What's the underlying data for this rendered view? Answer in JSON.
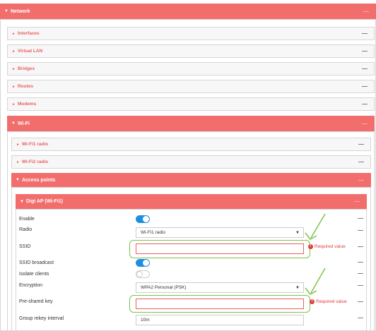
{
  "network": {
    "title": "Network",
    "arrow": "▼",
    "dash": "—"
  },
  "sections": [
    {
      "label": "Interfaces",
      "arrow": "►",
      "dash": "—"
    },
    {
      "label": "Virtual LAN",
      "arrow": "►",
      "dash": "—"
    },
    {
      "label": "Bridges",
      "arrow": "►",
      "dash": "—"
    },
    {
      "label": "Routes",
      "arrow": "►",
      "dash": "—"
    },
    {
      "label": "Modems",
      "arrow": "►",
      "dash": "—"
    }
  ],
  "wifi": {
    "title": "Wi-Fi",
    "arrow": "▼",
    "dash": "—",
    "radios": [
      {
        "label": "Wi-Fi1 radio",
        "arrow": "►",
        "dash": "—"
      },
      {
        "label": "Wi-Fi2 radio",
        "arrow": "►",
        "dash": "—"
      }
    ],
    "access_points": {
      "title": "Access points",
      "arrow": "▼",
      "dash": "—"
    },
    "digi_ap": {
      "title": "Digi AP (Wi-Fi1)",
      "arrow": "▼",
      "dash": "—"
    }
  },
  "fields": {
    "enable": {
      "label": "Enable",
      "state": "on"
    },
    "radio": {
      "label": "Radio",
      "value": "Wi-Fi1 radio",
      "caret": "▼"
    },
    "ssid": {
      "label": "SSID",
      "value": "",
      "error": "Required value",
      "error_icon": "!"
    },
    "ssid_broadcast": {
      "label": "SSID broadcast",
      "state": "on"
    },
    "isolate_clients": {
      "label": "Isolate clients",
      "state": "off"
    },
    "encryption": {
      "label": "Encryption",
      "value": "WPA2 Personal (PSK)",
      "caret": "▼"
    },
    "psk": {
      "label": "Pre-shared key",
      "value": "",
      "error": "Required value",
      "error_icon": "!"
    },
    "group_rekey": {
      "label": "Group rekey interval",
      "value": "10m"
    }
  },
  "row_dash": "—",
  "colors": {
    "header": "#f26e6c",
    "toggle_on": "#1d8fe0",
    "error": "#e03c3a",
    "highlight": "#7cc24a"
  }
}
